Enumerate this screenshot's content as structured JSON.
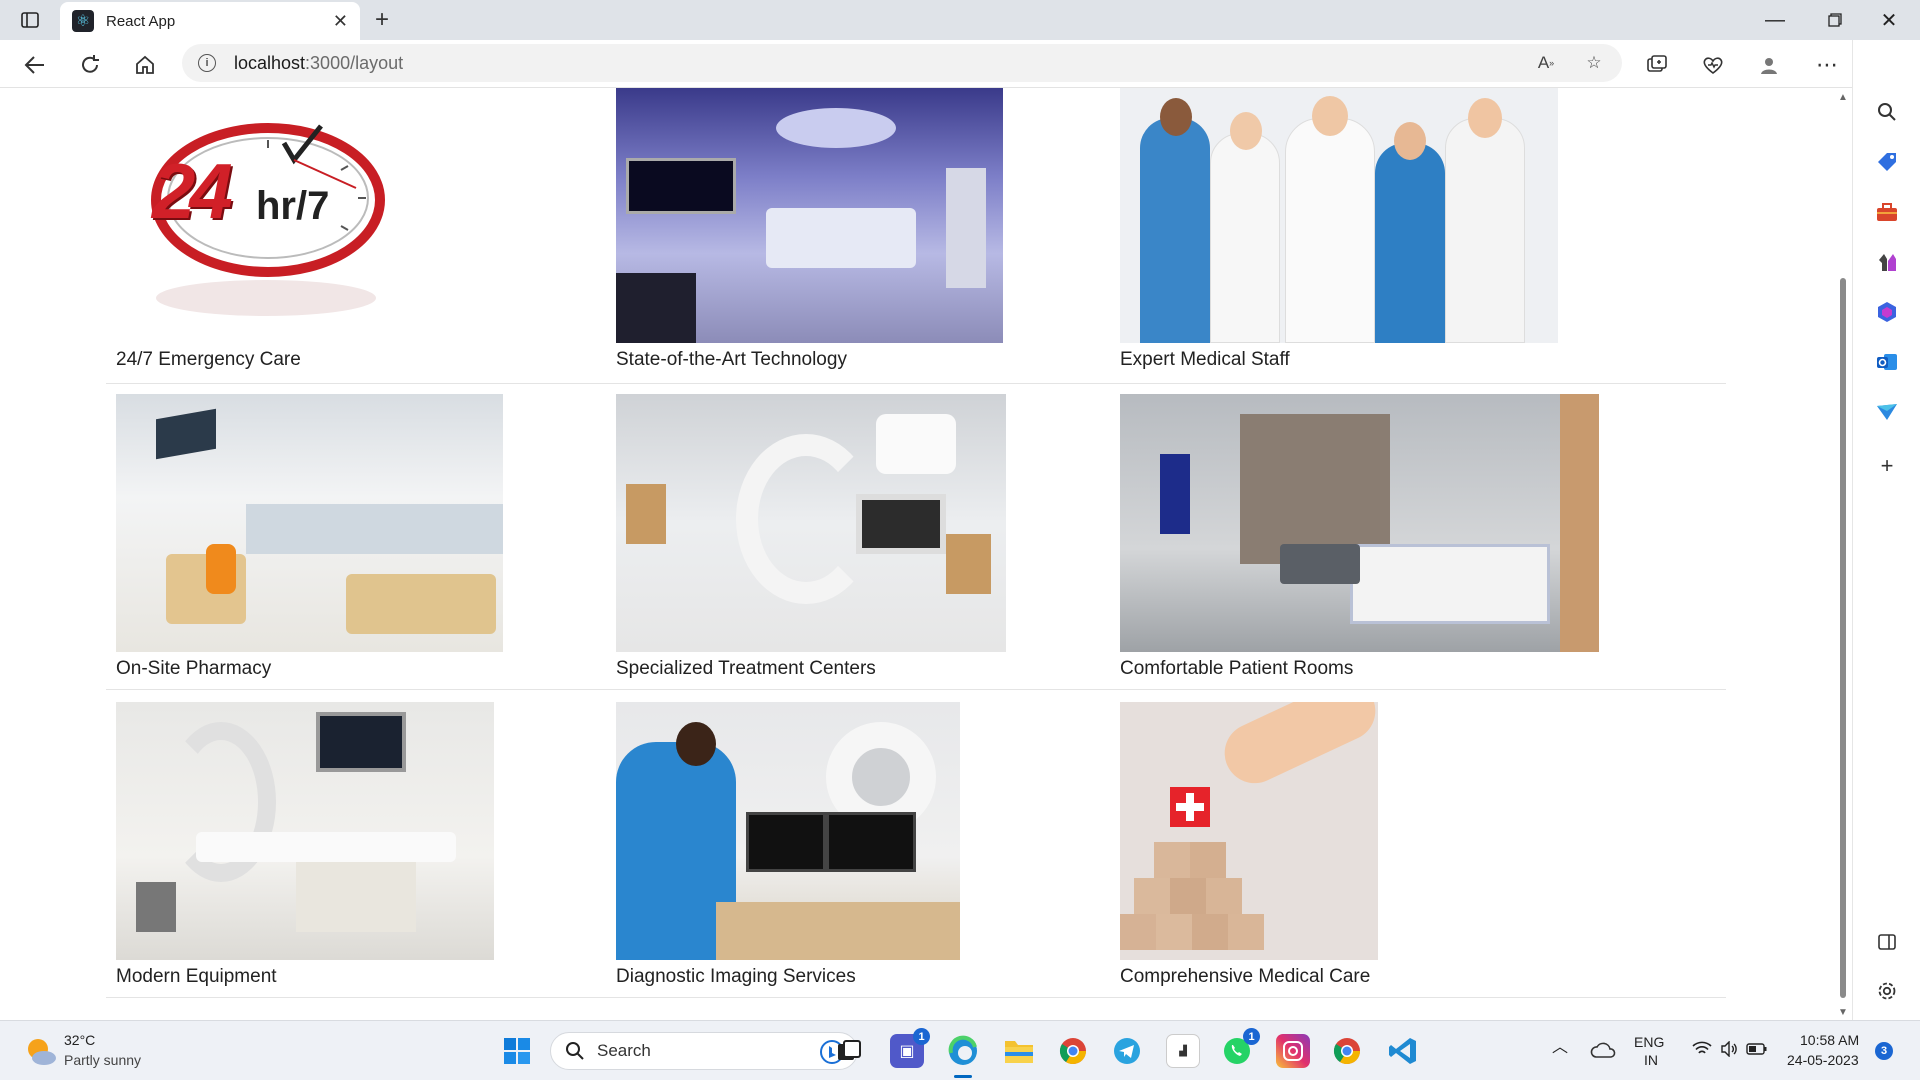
{
  "browser": {
    "tab_title": "React App",
    "new_tab_symbol": "+",
    "url_host": "localhost",
    "url_path": ":3000/layout"
  },
  "page": {
    "features": [
      {
        "caption": "24/7 Emergency Care",
        "image": "24hr-7-clock-logo"
      },
      {
        "caption": "State-of-the-Art Technology",
        "image": "operating-room-photo"
      },
      {
        "caption": "Expert Medical Staff",
        "image": "doctors-thumbs-up-photo"
      },
      {
        "caption": "On-Site Pharmacy",
        "image": "pharmacy-waiting-area-photo"
      },
      {
        "caption": "Specialized Treatment Centers",
        "image": "angiography-suite-photo"
      },
      {
        "caption": "Comfortable Patient Rooms",
        "image": "patient-room-photo"
      },
      {
        "caption": "Modern Equipment",
        "image": "cath-lab-equipment-photo"
      },
      {
        "caption": "Diagnostic Imaging Services",
        "image": "radiologist-ct-scanner-photo"
      },
      {
        "caption": "Comprehensive Medical Care",
        "image": "red-cross-wooden-blocks-photo"
      }
    ],
    "emergency_logo_text": {
      "big": "24",
      "small": "hr/7"
    }
  },
  "taskbar": {
    "weather_temp": "32°C",
    "weather_desc": "Partly sunny",
    "search_label": "Search",
    "teams_badge": "1",
    "whatsapp_badge": "1",
    "lang_top": "ENG",
    "lang_bottom": "IN",
    "time": "10:58 AM",
    "date": "24-05-2023",
    "notification_count": "3"
  },
  "colors": {
    "accent": "#0067c0",
    "caption_text": "#222222",
    "divider": "#e4e4e4"
  }
}
